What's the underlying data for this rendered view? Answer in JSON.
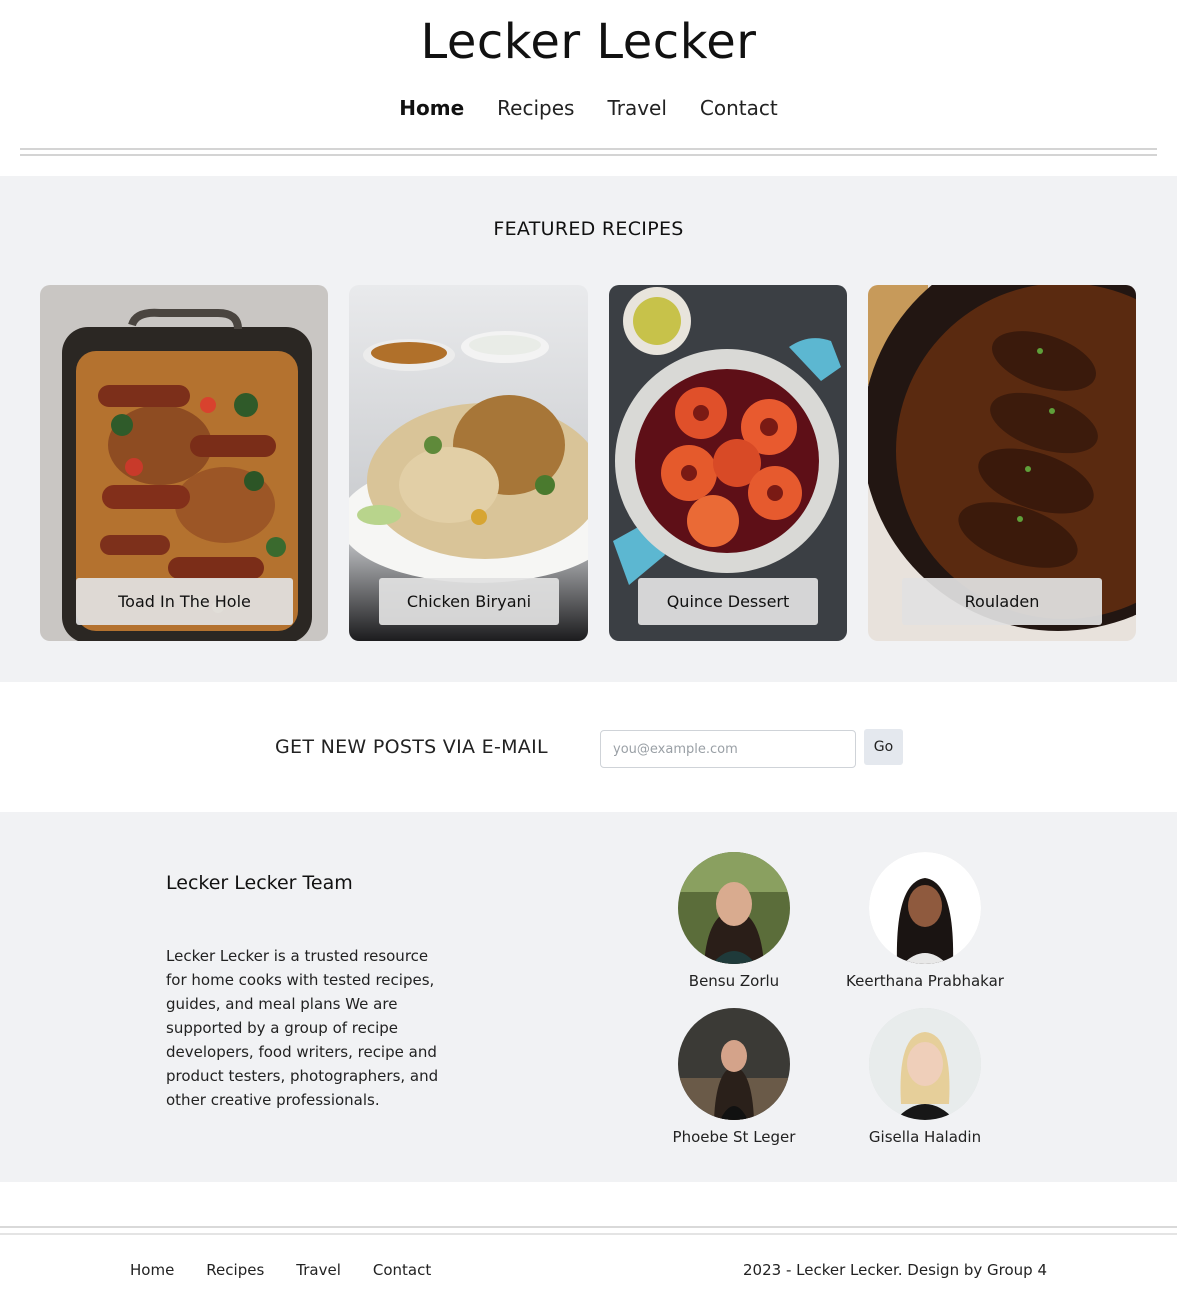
{
  "site": {
    "title": "Lecker Lecker"
  },
  "nav": {
    "items": [
      {
        "label": "Home",
        "active": true
      },
      {
        "label": "Recipes"
      },
      {
        "label": "Travel"
      },
      {
        "label": "Contact"
      }
    ]
  },
  "featured": {
    "title": "FEATURED RECIPES",
    "recipes": [
      {
        "name": "Toad In The Hole"
      },
      {
        "name": "Chicken Biryani"
      },
      {
        "name": "Quince Dessert"
      },
      {
        "name": "Rouladen"
      }
    ]
  },
  "newsletter": {
    "label": "GET NEW POSTS VIA E-MAIL",
    "placeholder": "you@example.com",
    "button": "Go"
  },
  "team": {
    "title": "Lecker Lecker Team",
    "description": "Lecker Lecker is a trusted resource for home cooks with tested recipes, guides, and meal plans We are supported by a group of recipe developers, food writers, recipe and product testers, photographers, and other creative professionals.",
    "members": [
      {
        "name": "Bensu Zorlu"
      },
      {
        "name": "Keerthana Prabhakar"
      },
      {
        "name": "Phoebe St Leger"
      },
      {
        "name": "Gisella Haladin"
      }
    ]
  },
  "footer": {
    "nav": [
      "Home",
      "Recipes",
      "Travel",
      "Contact"
    ],
    "copyright": "2023 - Lecker Lecker. Design by Group 4"
  }
}
